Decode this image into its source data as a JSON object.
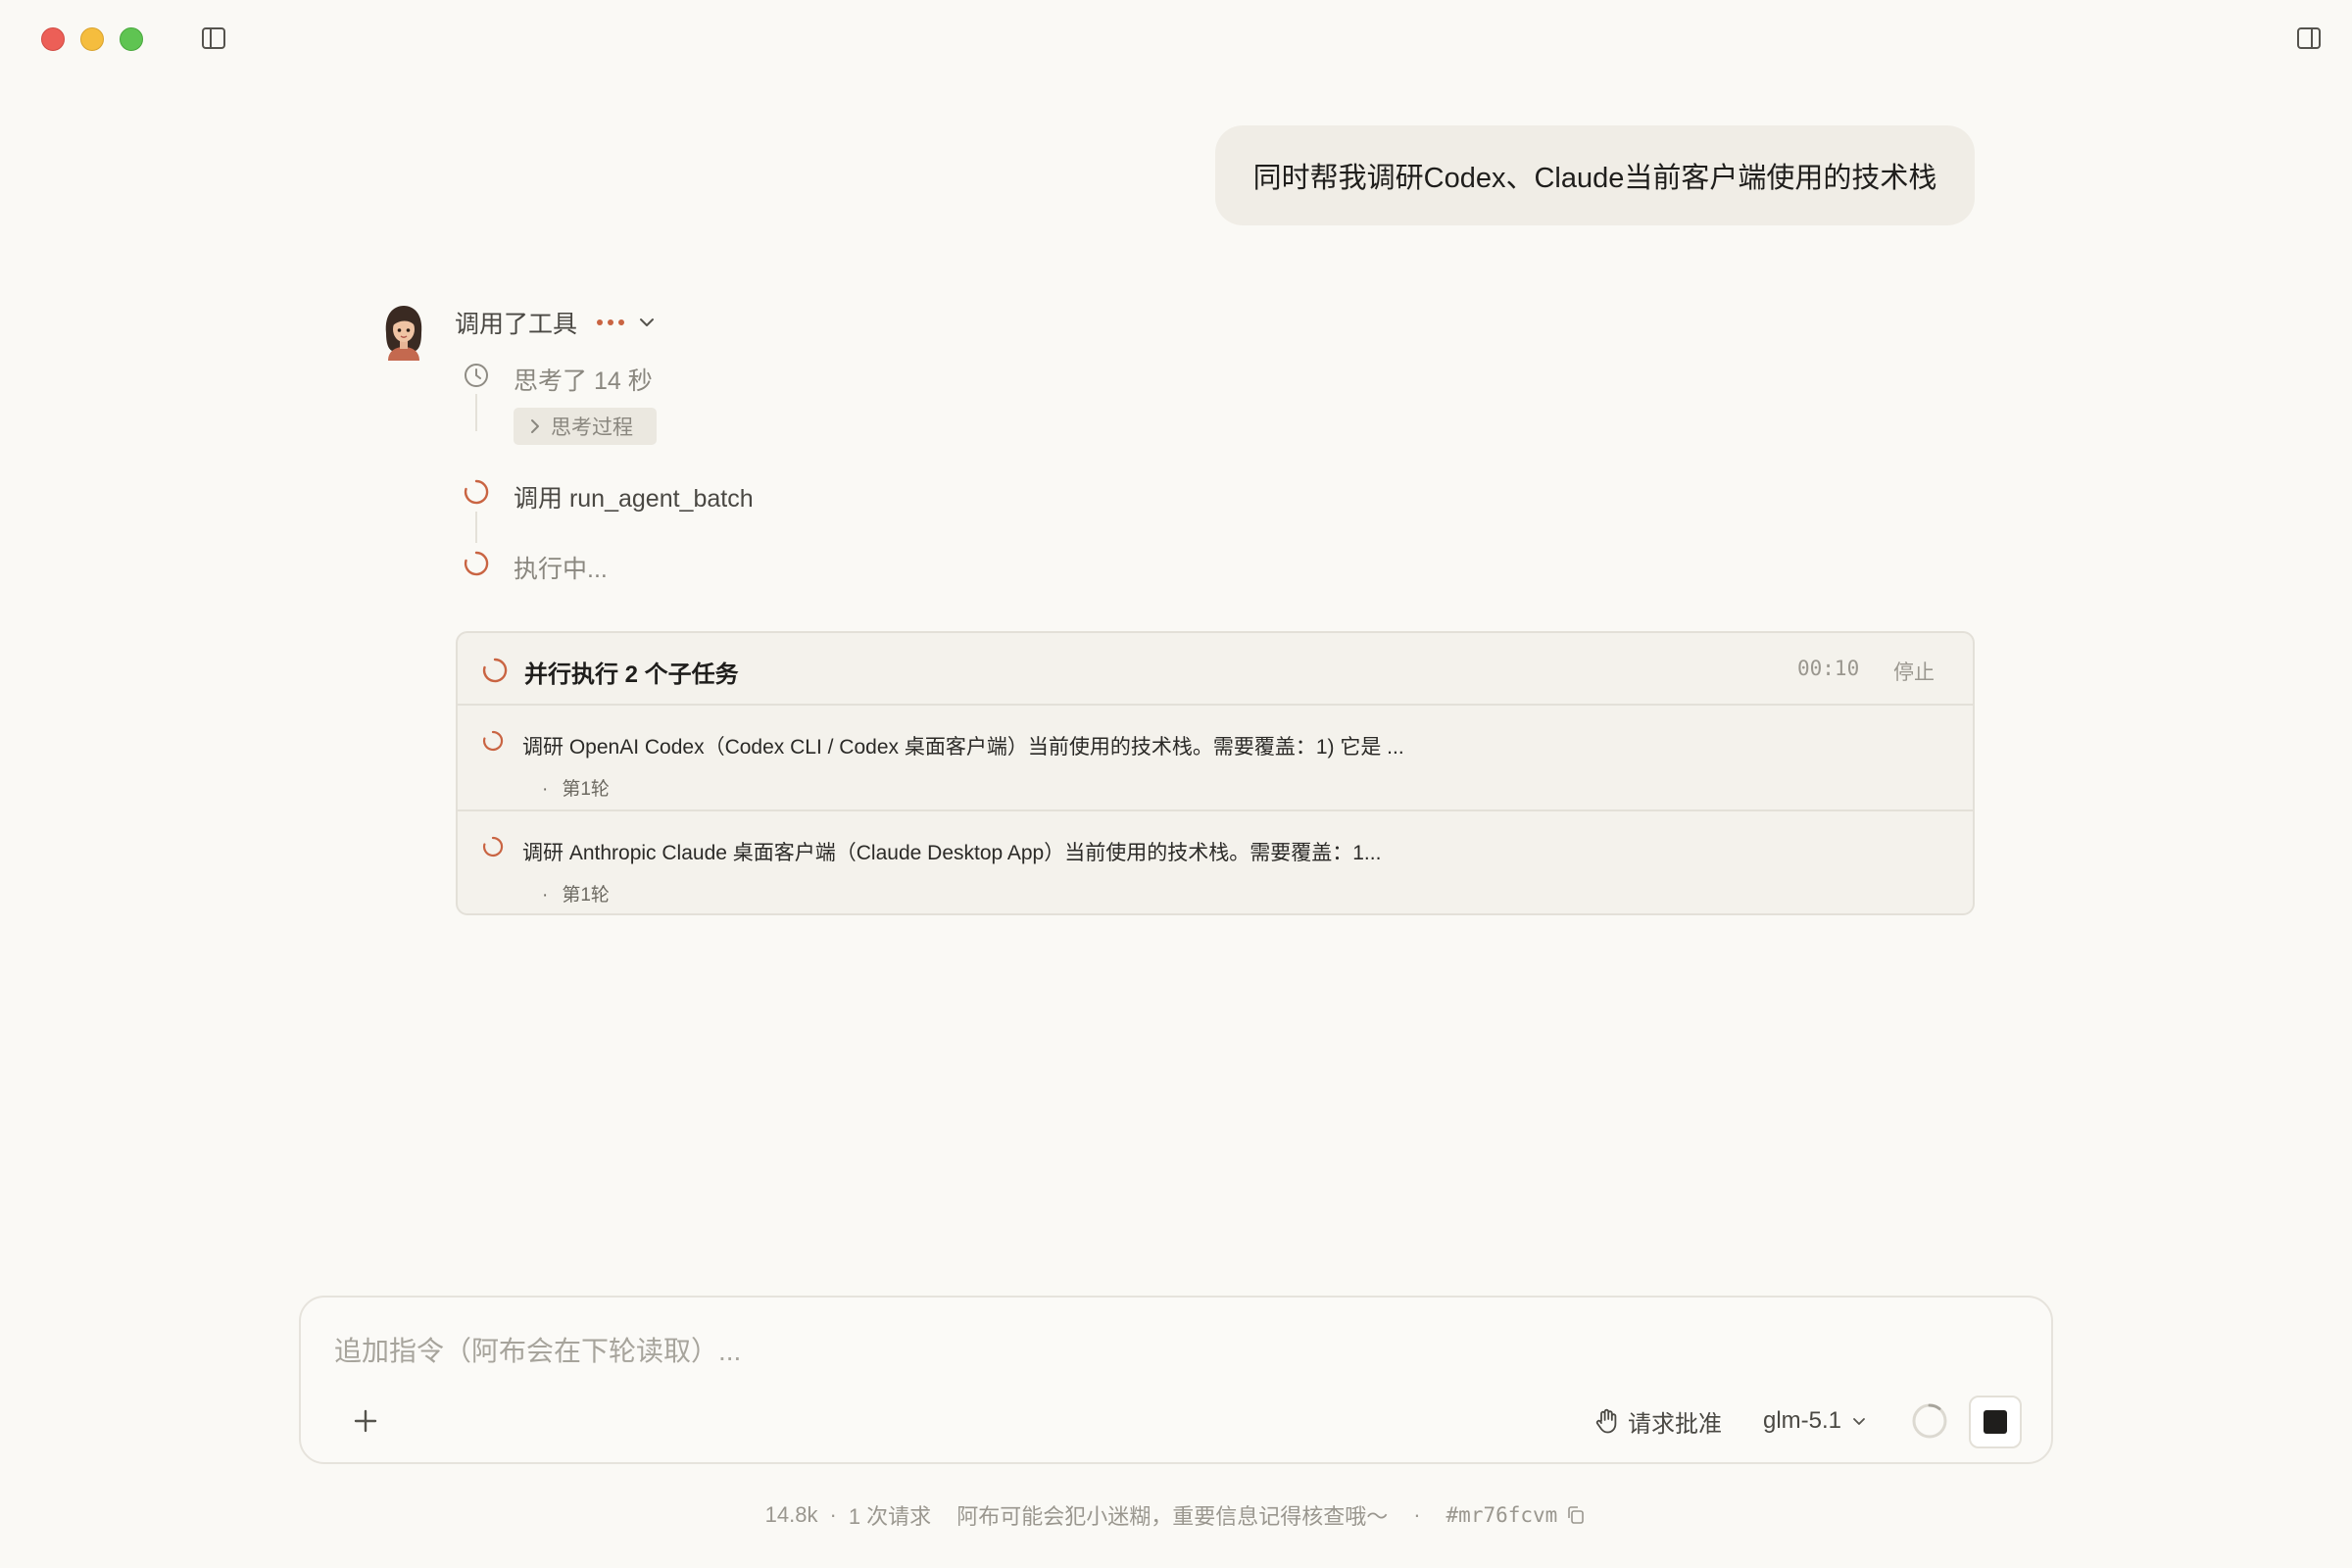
{
  "user_message": "同时帮我调研Codex、Claude当前客户端使用的技术栈",
  "agent": {
    "header_label": "调用了工具",
    "steps": [
      {
        "icon": "clock-icon",
        "text": "思考了 14 秒"
      },
      {
        "icon": "spinner-icon",
        "text": "调用 run_agent_batch"
      },
      {
        "icon": "spinner-icon",
        "text": "执行中..."
      }
    ],
    "thinking_button": "思考过程"
  },
  "task_panel": {
    "title": "并行执行 2 个子任务",
    "timer": "00:10",
    "stop_label": "停止",
    "tasks": [
      {
        "text": "调研 OpenAI Codex（Codex CLI / Codex 桌面客户端）当前使用的技术栈。需要覆盖：1) 它是 ...",
        "round": "第1轮"
      },
      {
        "text": "调研 Anthropic Claude 桌面客户端（Claude Desktop App）当前使用的技术栈。需要覆盖：1...",
        "round": "第1轮"
      }
    ]
  },
  "composer": {
    "placeholder": "追加指令（阿布会在下轮读取）...",
    "approve_label": "请求批准",
    "model": "glm-5.1"
  },
  "footer": {
    "tokens": "14.8k",
    "requests": "1 次请求",
    "disclaimer": "阿布可能会犯小迷糊，重要信息记得核查哦～",
    "hash": "#mr76fcvm"
  },
  "colors": {
    "background": "#faf9f5",
    "accent": "#c96442",
    "bubble": "#f0ede6"
  }
}
